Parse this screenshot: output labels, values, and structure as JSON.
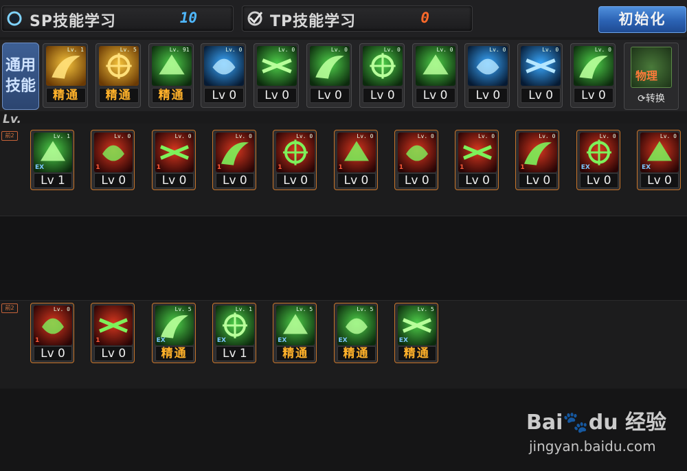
{
  "header": {
    "sp": {
      "label": "SP技能学习",
      "value": "10"
    },
    "tp": {
      "label": "TP技能学习",
      "value": "0"
    },
    "reset_label": "初始化"
  },
  "general": {
    "label_line1": "通用",
    "label_line2": "技能",
    "switch_icon_text": "物理",
    "switch_label": "⟳转换",
    "skills": [
      {
        "lv": "精通",
        "theme": "gold",
        "icon_lv": "Lv. 1"
      },
      {
        "lv": "精通",
        "theme": "gold",
        "icon_lv": "Lv. 5"
      },
      {
        "lv": "精通",
        "theme": "green",
        "icon_lv": "Lv. 91"
      },
      {
        "lv": "Lv 0",
        "theme": "blue",
        "icon_lv": "Lv. 0"
      },
      {
        "lv": "Lv 0",
        "theme": "green",
        "icon_lv": "Lv. 0"
      },
      {
        "lv": "Lv 0",
        "theme": "green",
        "icon_lv": "Lv. 0"
      },
      {
        "lv": "Lv 0",
        "theme": "green",
        "icon_lv": "Lv. 0"
      },
      {
        "lv": "Lv 0",
        "theme": "green",
        "icon_lv": "Lv. 0"
      },
      {
        "lv": "Lv 0",
        "theme": "blue",
        "icon_lv": "Lv. 0"
      },
      {
        "lv": "Lv 0",
        "theme": "blue",
        "icon_lv": "Lv. 0"
      },
      {
        "lv": "Lv 0",
        "theme": "green",
        "icon_lv": "Lv. 0"
      }
    ]
  },
  "lv_header": "Lv.",
  "row_tag": "前2",
  "row1": [
    {
      "lv": "Lv 1",
      "theme": "green",
      "badge": "EX",
      "icon_lv": "Lv. 1"
    },
    {
      "lv": "Lv 0",
      "theme": "red",
      "badge": "1",
      "icon_lv": "Lv. 0"
    },
    {
      "lv": "Lv 0",
      "theme": "red",
      "badge": "1",
      "icon_lv": "Lv. 0"
    },
    {
      "lv": "Lv 0",
      "theme": "red",
      "badge": "1",
      "icon_lv": "Lv. 0"
    },
    {
      "lv": "Lv 0",
      "theme": "red",
      "badge": "1",
      "icon_lv": "Lv. 0"
    },
    {
      "lv": "Lv 0",
      "theme": "red",
      "badge": "1",
      "icon_lv": "Lv. 0"
    },
    {
      "lv": "Lv 0",
      "theme": "red",
      "badge": "1",
      "icon_lv": "Lv. 0"
    },
    {
      "lv": "Lv 0",
      "theme": "red",
      "badge": "1",
      "icon_lv": "Lv. 0"
    },
    {
      "lv": "Lv 0",
      "theme": "red",
      "badge": "1",
      "icon_lv": "Lv. 0"
    },
    {
      "lv": "Lv 0",
      "theme": "red",
      "badge": "EX",
      "icon_lv": "Lv. 0"
    },
    {
      "lv": "Lv 0",
      "theme": "red",
      "badge": "EX",
      "icon_lv": "Lv. 0"
    }
  ],
  "row2": [
    {
      "lv": "Lv 0",
      "theme": "red",
      "badge": "1",
      "icon_lv": "Lv. 0"
    },
    {
      "lv": "Lv 0",
      "theme": "red",
      "badge": "1",
      "icon_lv": ""
    },
    {
      "lv": "精通",
      "theme": "green",
      "badge": "EX",
      "icon_lv": "Lv. 5"
    },
    {
      "lv": "Lv 1",
      "theme": "green",
      "badge": "EX",
      "icon_lv": "Lv. 1"
    },
    {
      "lv": "精通",
      "theme": "green",
      "badge": "EX",
      "icon_lv": "Lv. 5"
    },
    {
      "lv": "精通",
      "theme": "green",
      "badge": "EX",
      "icon_lv": "Lv. 5"
    },
    {
      "lv": "精通",
      "theme": "green",
      "badge": "EX",
      "icon_lv": "Lv. 5"
    }
  ],
  "watermark": {
    "main": "Bai🐾du 经验",
    "sub": "jingyan.baidu.com"
  },
  "colors": {
    "gold": "#c8921e",
    "green": "#3fae3a",
    "red": "#c22b1c",
    "blue": "#2a8bd6",
    "master": "#ffb12a",
    "sp_value": "#4fb8ff",
    "tp_value": "#ff6a2a"
  }
}
